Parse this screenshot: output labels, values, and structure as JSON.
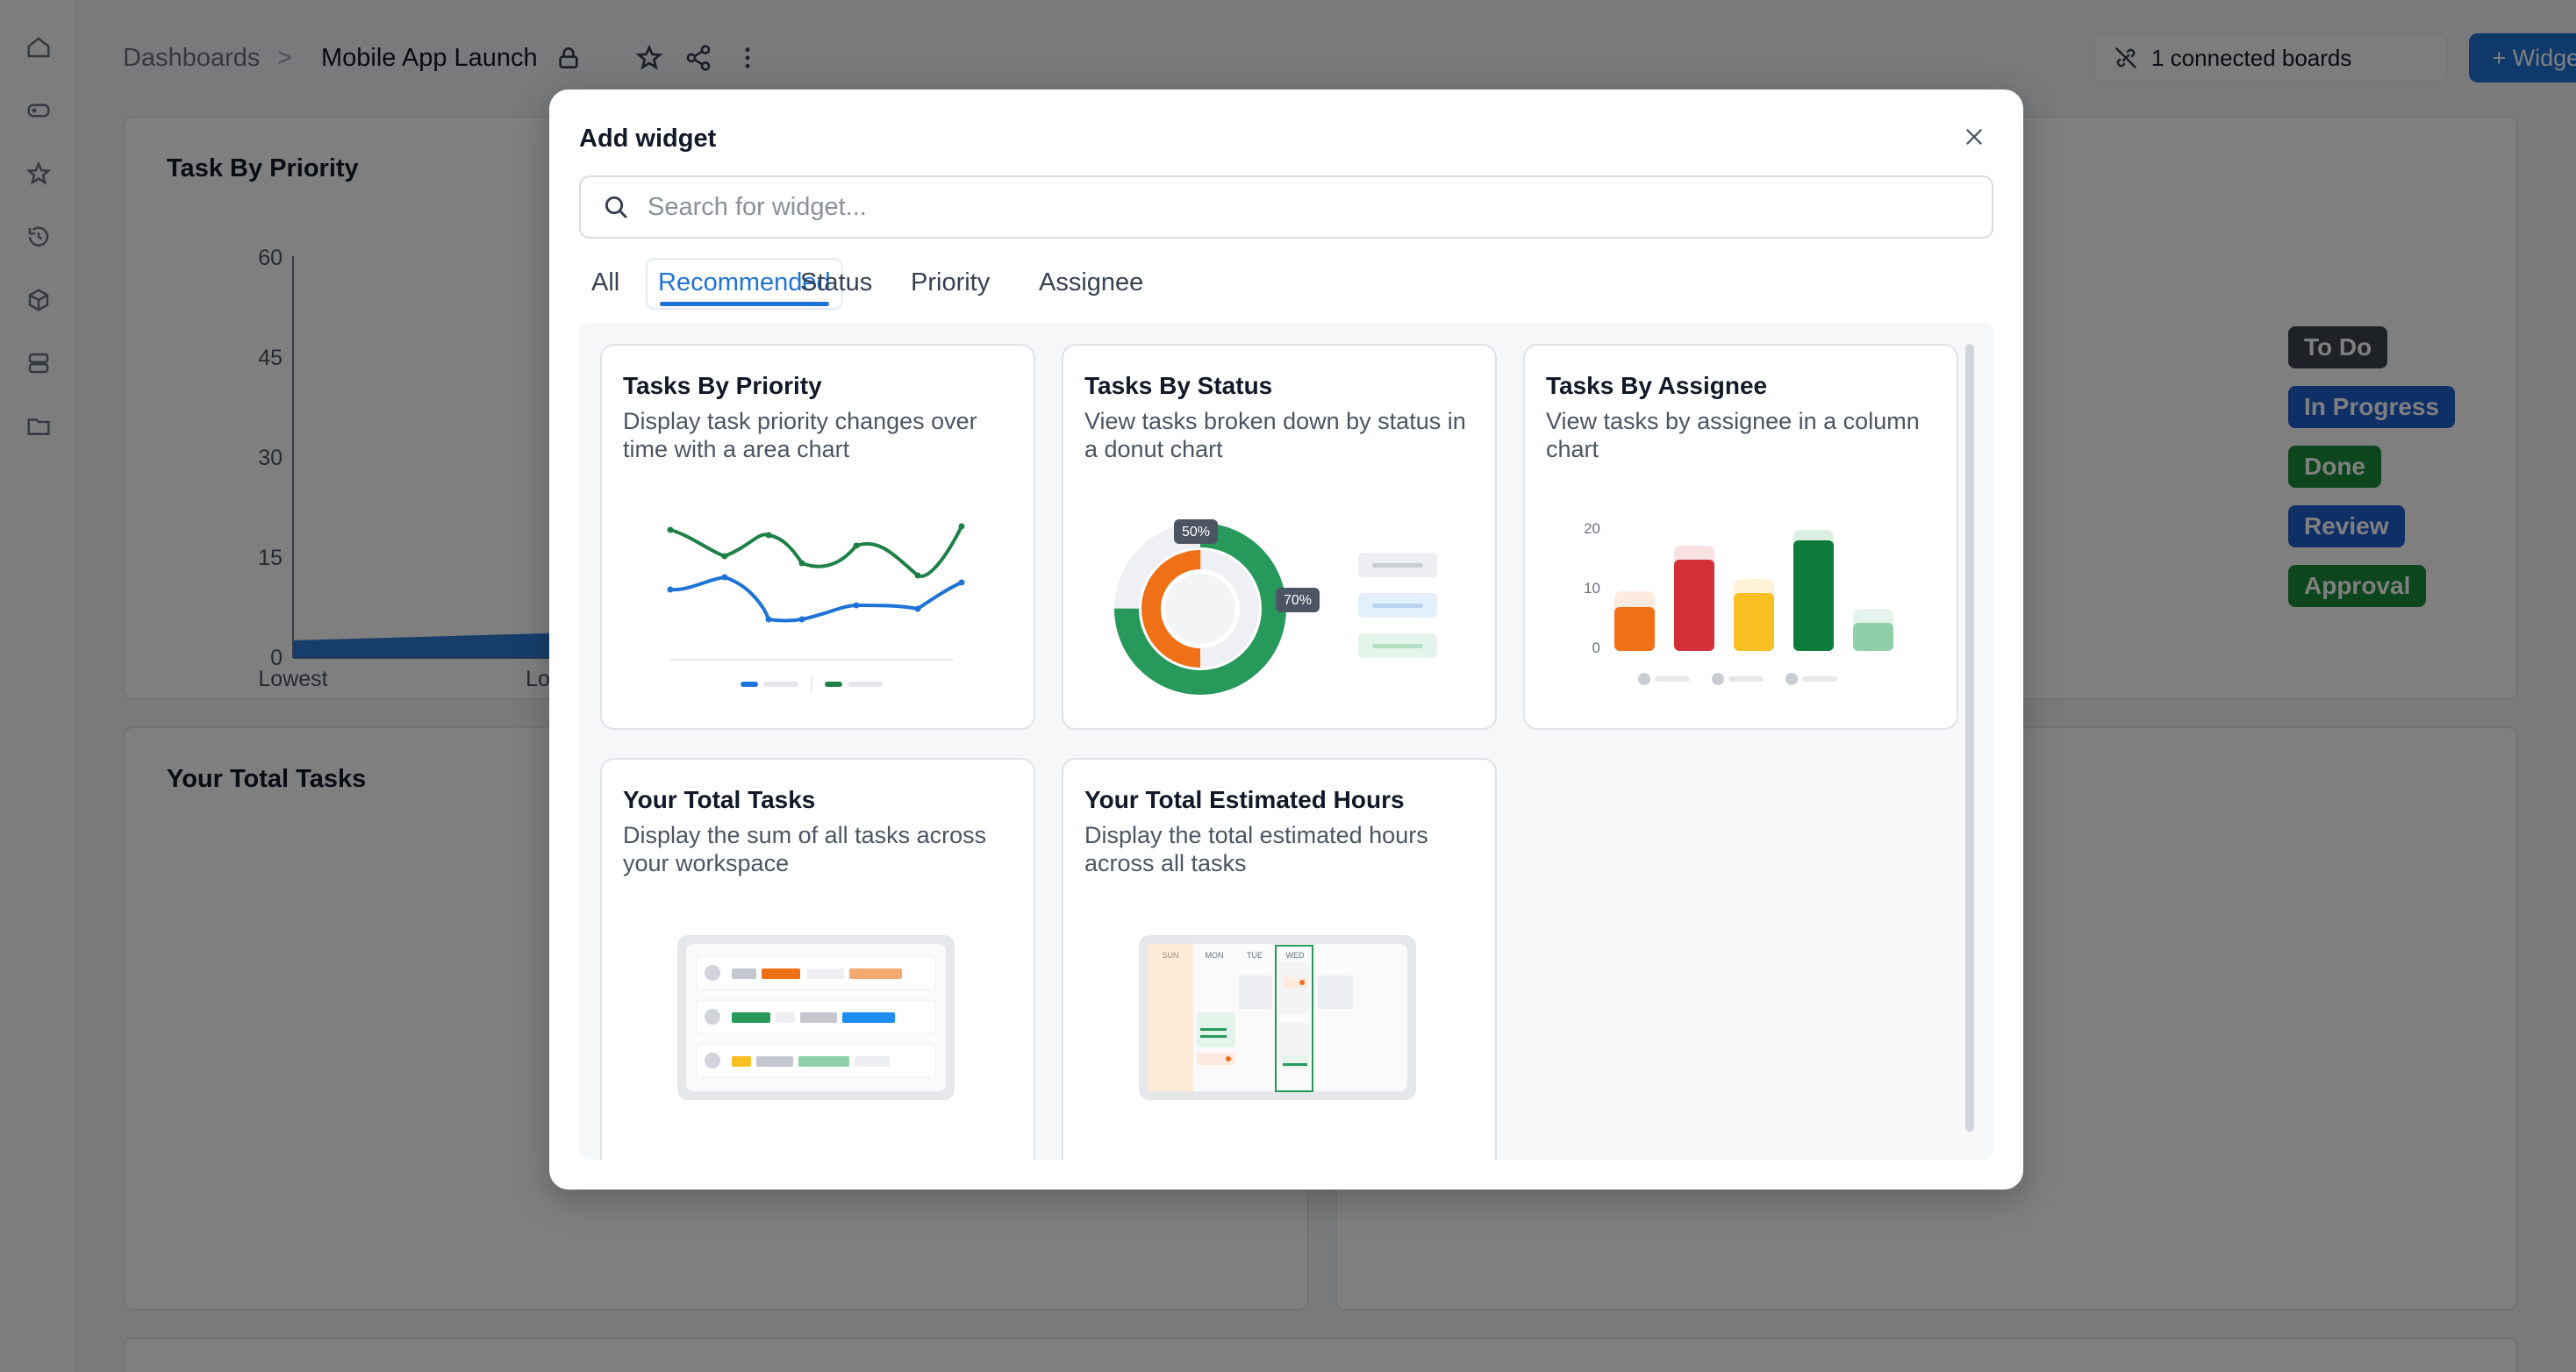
{
  "breadcrumb": {
    "root": "Dashboards",
    "separator": ">",
    "current": "Mobile App Launch"
  },
  "header": {
    "connected_label": "1 connected boards",
    "widget_button_label": "+ Widget"
  },
  "background_panels": {
    "priority_title": "Task By Priority",
    "total_tasks_title": "Your Total Tasks",
    "chart": {
      "y_ticks": [
        "60",
        "45",
        "30",
        "15",
        "0"
      ],
      "x_ticks": [
        "Lowest",
        "Low"
      ]
    },
    "status_legend": [
      {
        "label": "To Do",
        "color": "#3d434b"
      },
      {
        "label": "In Progress",
        "color": "#1e5fcf"
      },
      {
        "label": "Done",
        "color": "#1a8a3a"
      },
      {
        "label": "Review",
        "color": "#1e5fcf"
      },
      {
        "label": "Approval",
        "color": "#1a8a3a"
      }
    ]
  },
  "modal": {
    "title": "Add widget",
    "search_placeholder": "Search for widget...",
    "tabs": [
      "All",
      "Recommended",
      "Status",
      "Priority",
      "Assignee"
    ],
    "active_tab": "Recommended",
    "cards": [
      {
        "title": "Tasks By Priority",
        "description": "Display task priority changes over time with a area chart"
      },
      {
        "title": "Tasks By Status",
        "description": "View tasks broken down by status in a donut chart"
      },
      {
        "title": "Tasks By Assignee",
        "description": "View tasks by assignee in a column chart"
      },
      {
        "title": "Your Total Tasks",
        "description": "Display the sum of all tasks across your workspace"
      },
      {
        "title": "Your Total Estimated Hours",
        "description": "Display the total estimated hours across all tasks"
      }
    ],
    "status_illustration": {
      "outer_label": "50%",
      "inner_label": "70%"
    },
    "assignee_illustration": {
      "y_ticks": [
        "20",
        "10",
        "0"
      ]
    },
    "calendar_illustration": {
      "days": [
        "SUN",
        "MON",
        "TUE",
        "WED"
      ]
    }
  },
  "colors": {
    "accent": "#1e73d6",
    "green": "#1f9d57",
    "orange": "#f07018",
    "red": "#d3303a",
    "yellow": "#fbbf24",
    "dark_green": "#0e7a3c"
  }
}
